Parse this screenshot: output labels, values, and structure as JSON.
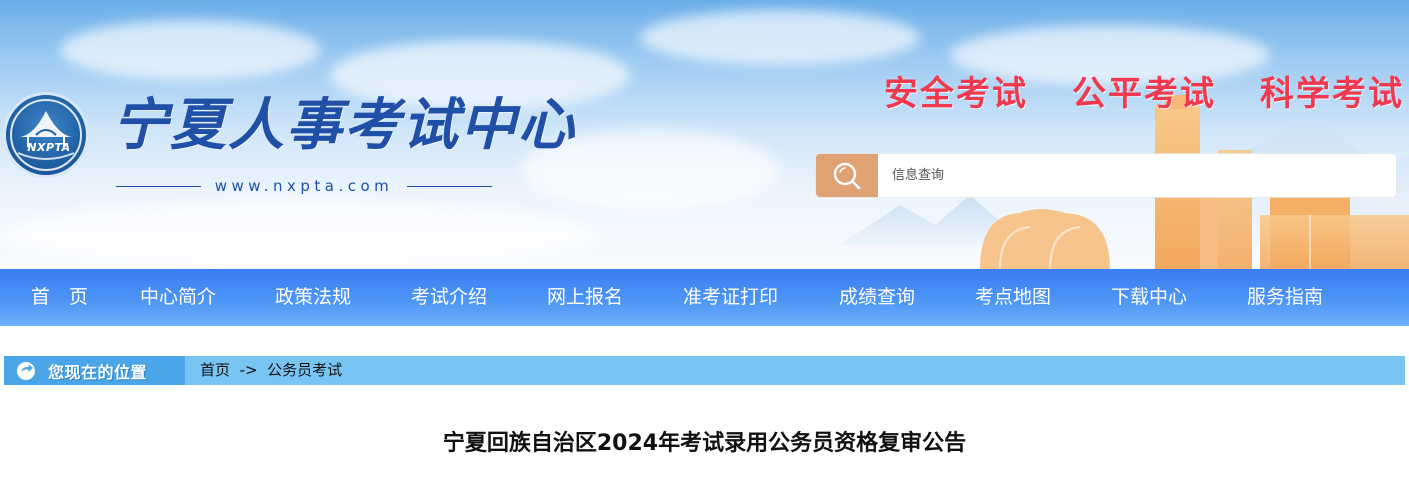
{
  "header": {
    "logo_abbr": "NXPTA",
    "site_name": "宁夏人事考试中心",
    "site_url": "www.nxpta.com",
    "slogans": [
      "安全考试",
      "公平考试",
      "科学考试"
    ],
    "search": {
      "placeholder": "信息查询",
      "icon": "search-icon"
    }
  },
  "nav": {
    "items": [
      {
        "label": "首　页"
      },
      {
        "label": "中心简介"
      },
      {
        "label": "政策法规"
      },
      {
        "label": "考试介绍"
      },
      {
        "label": "网上报名"
      },
      {
        "label": "准考证打印"
      },
      {
        "label": "成绩查询"
      },
      {
        "label": "考点地图"
      },
      {
        "label": "下载中心"
      },
      {
        "label": "服务指南"
      }
    ]
  },
  "breadcrumb": {
    "tag": "您现在的位置",
    "home": "首页",
    "separator": "->",
    "current": "公务员考试"
  },
  "article": {
    "title": "宁夏回族自治区2024年考试录用公务员资格复审公告"
  },
  "colors": {
    "nav_bg": "#4d95f6",
    "slogan": "#f0394f",
    "search_button": "#e0a274",
    "breadcrumb_bg": "#78c4f3",
    "site_name": "#1f4fa6"
  }
}
